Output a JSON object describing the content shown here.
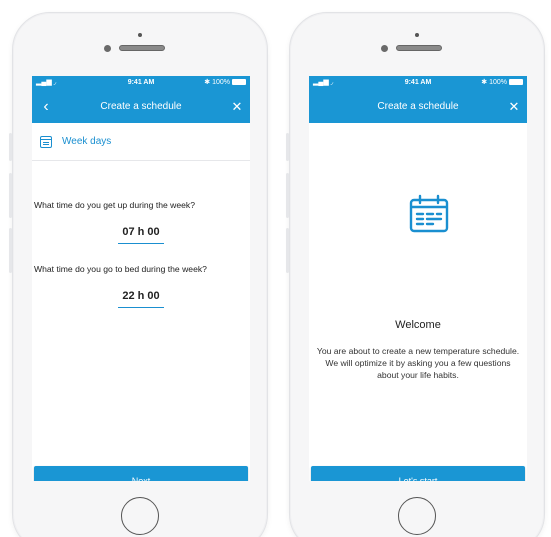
{
  "colors": {
    "accent": "#1a96d4",
    "phone_body": "#f6f6f7",
    "screen_bg": "#ffffff"
  },
  "status_bar": {
    "signal": "▂▄▆ ◞",
    "time": "9:41 AM",
    "battery": "✱ 100%"
  },
  "left_screen": {
    "nav": {
      "back_icon": "‹",
      "title": "Create a schedule",
      "close_icon": "✕"
    },
    "section": {
      "icon": "calendar-icon",
      "label": "Week days"
    },
    "question_wake": "What time do you get up during the week?",
    "wake_time": "07 h 00",
    "question_bed": "What time do you go to bed during the week?",
    "bed_time": "22 h 00",
    "next_label": "Next"
  },
  "right_screen": {
    "nav": {
      "title": "Create a schedule",
      "close_icon": "✕"
    },
    "icon": "calendar-icon",
    "welcome_title": "Welcome",
    "welcome_text": "You are about to create a new temperature schedule. We will optimize it by asking you a few questions about your life habits.",
    "start_label": "Let's start"
  }
}
